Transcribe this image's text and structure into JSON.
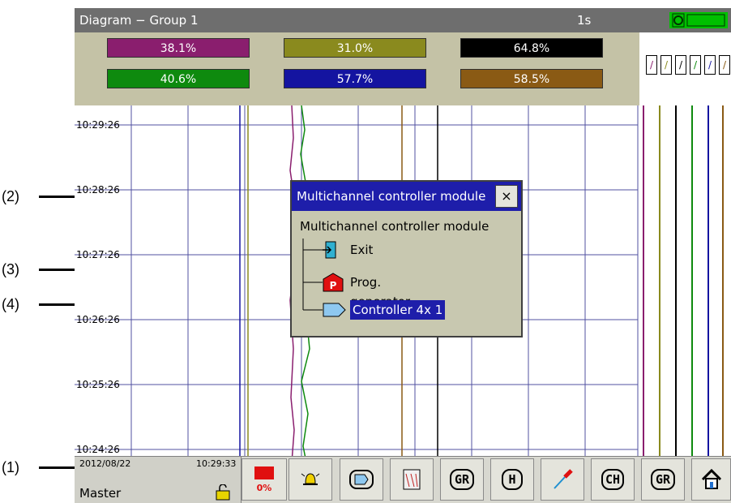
{
  "titlebar": {
    "title": "Diagram − Group 1",
    "interval": "1s"
  },
  "values": [
    {
      "text": "38.1%",
      "color": "#8a1e6e"
    },
    {
      "text": "31.0%",
      "color": "#8a8a1e"
    },
    {
      "text": "64.8%",
      "color": "#000000"
    },
    {
      "text": "40.6%",
      "color": "#0e8a0e"
    },
    {
      "text": "57.7%",
      "color": "#1414a0"
    },
    {
      "text": "58.5%",
      "color": "#8a5a14"
    }
  ],
  "legend_colors": [
    "#8a1e6e",
    "#8a8a1e",
    "#000000",
    "#0e8a0e",
    "#1414a0",
    "#8a5a14"
  ],
  "time_labels": [
    "10:29:26",
    "10:28:26",
    "10:27:26",
    "10:26:26",
    "10:25:26",
    "10:24:26"
  ],
  "taskbar": {
    "date": "2012/08/22",
    "time": "10:29:33",
    "user": "Master",
    "memory": "0%",
    "buttons": [
      "GR",
      "H",
      "CH",
      "GR"
    ]
  },
  "dialog": {
    "title": "Multichannel controller module",
    "close": "×",
    "heading": "Multichannel controller module",
    "items": [
      {
        "label": "Exit",
        "icon": "exit-icon"
      },
      {
        "label": "Prog. generator",
        "icon": "program-generator-icon"
      },
      {
        "label": "Controller 4x 1",
        "icon": "controller-icon"
      }
    ]
  },
  "callouts": [
    "(1)",
    "(2)",
    "(3)",
    "(4)"
  ]
}
